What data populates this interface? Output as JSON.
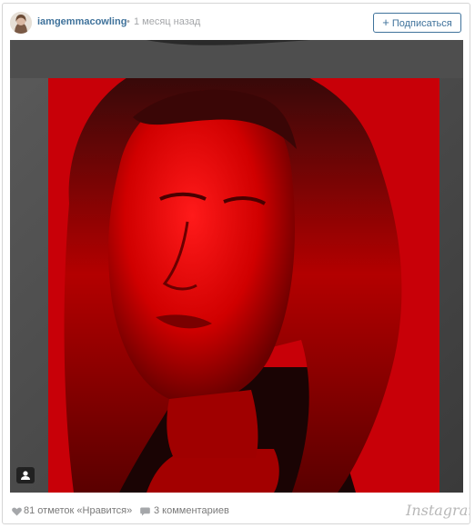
{
  "post": {
    "username": "iamgemmacowling",
    "separator": "•",
    "time": "1 месяц назад",
    "follow_label": "Подписаться",
    "follow_plus": "+",
    "photo_icon": "user-tag-icon"
  },
  "footer": {
    "likes": "81 отметок «Нравится»",
    "comments": "3 комментариев",
    "logo": "Instagram"
  },
  "colors": {
    "username": "#3f729b",
    "muted": "#a5a7aa",
    "photo_red": "#d8000a"
  }
}
